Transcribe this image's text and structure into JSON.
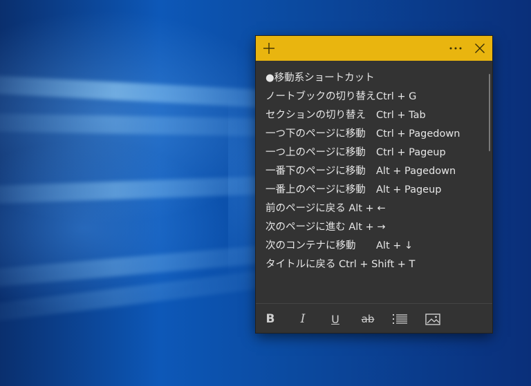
{
  "note": {
    "titlebar": {
      "add_icon": "plus-icon",
      "more_icon": "more-icon",
      "close_icon": "close-icon"
    },
    "lines": [
      {
        "label": "●移動系ショートカット",
        "keys": ""
      },
      {
        "label": "ノートブックの切り替え",
        "keys": "Ctrl + G"
      },
      {
        "label": "セクションの切り替え",
        "keys": "Ctrl + Tab"
      },
      {
        "label": "一つ下のページに移動",
        "keys": "Ctrl + Pagedown"
      },
      {
        "label": "一つ上のページに移動",
        "keys": "Ctrl + Pageup"
      },
      {
        "label": "一番下のページに移動",
        "keys": "Alt + Pagedown"
      },
      {
        "label": "一番上のページに移動",
        "keys": "Alt + Pageup"
      },
      {
        "label": "前のページに戻る Alt + ←",
        "keys": ""
      },
      {
        "label": "次のページに進む Alt + →",
        "keys": ""
      },
      {
        "label": "次のコンテナに移動",
        "keys": "Alt + ↓"
      },
      {
        "label": "タイトルに戻る",
        "keys": "Ctrl + Shift + T"
      }
    ],
    "toolbar": {
      "bold": "B",
      "italic": "I",
      "underline": "U",
      "strikethrough": "ab",
      "list_icon": "bullet-list-icon",
      "image_icon": "image-icon"
    },
    "colors": {
      "titlebar": "#e9b50f",
      "body": "#333333",
      "text": "#e6e6e6"
    }
  }
}
